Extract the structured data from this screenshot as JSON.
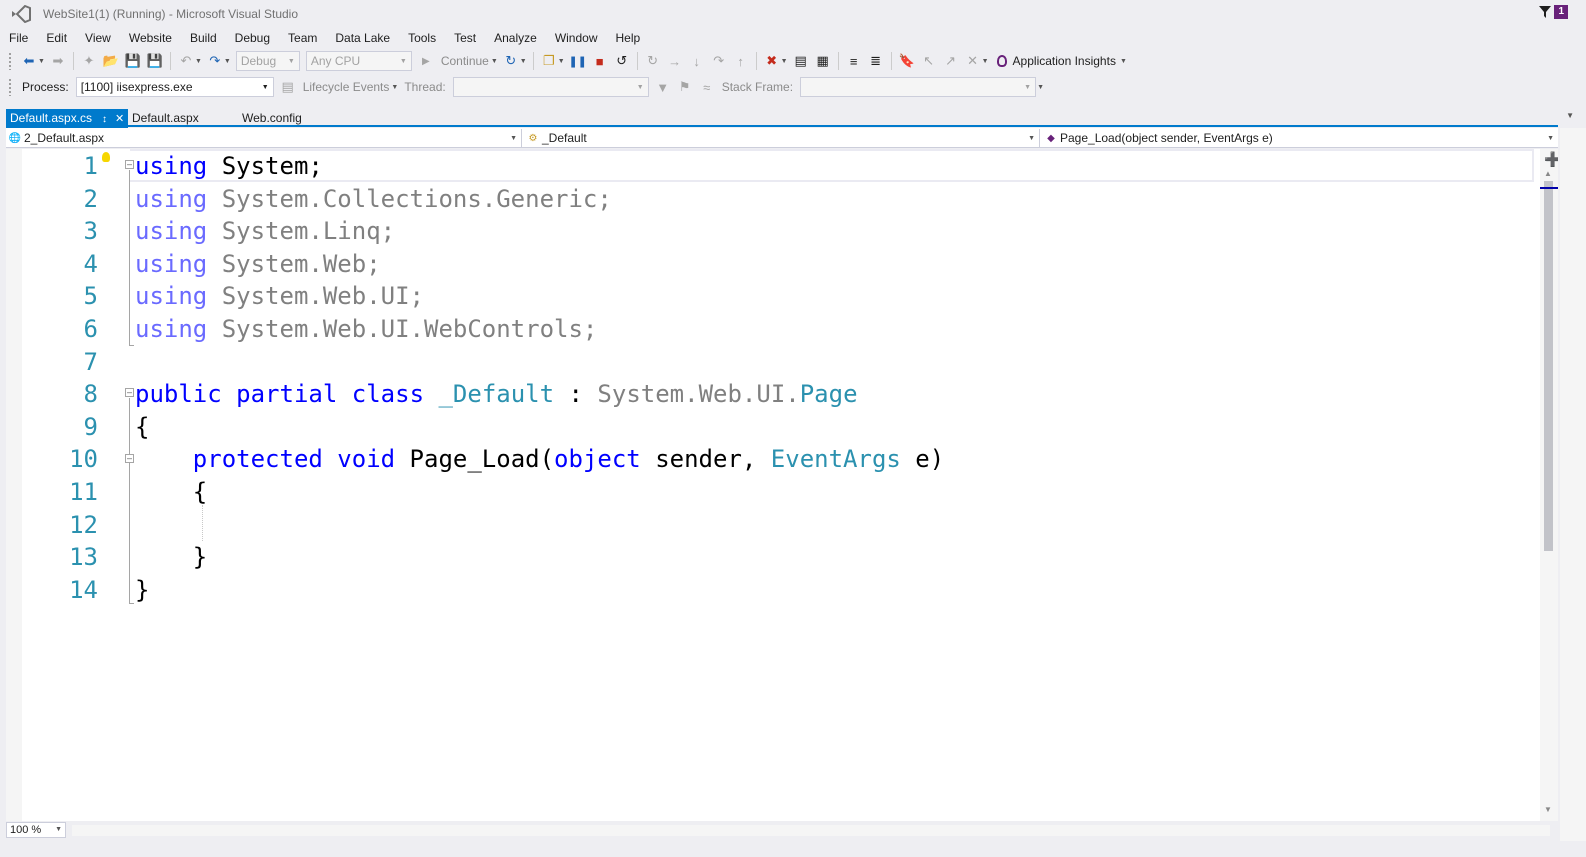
{
  "window": {
    "title": "WebSite1(1) (Running) - Microsoft Visual Studio",
    "notification_count": "1"
  },
  "menu": [
    "File",
    "Edit",
    "View",
    "Website",
    "Build",
    "Debug",
    "Team",
    "Data Lake",
    "Tools",
    "Test",
    "Analyze",
    "Window",
    "Help"
  ],
  "toolbar": {
    "configuration": "Debug",
    "platform": "Any CPU",
    "continue_label": "Continue",
    "app_insights_label": "Application Insights"
  },
  "debug_location": {
    "process_label": "Process:",
    "process_value": "[1100] iisexpress.exe",
    "lifecycle_label": "Lifecycle Events",
    "thread_label": "Thread:",
    "thread_value": "",
    "stack_frame_label": "Stack Frame:",
    "stack_frame_value": ""
  },
  "tabs": [
    {
      "label": "Default.aspx.cs",
      "active": true
    },
    {
      "label": "Default.aspx",
      "active": false
    },
    {
      "label": "Web.config",
      "active": false
    }
  ],
  "navbar": {
    "project": "2_Default.aspx",
    "type": "_Default",
    "member": "Page_Load(object sender, EventArgs e)"
  },
  "code": {
    "line_numbers": [
      "1",
      "2",
      "3",
      "4",
      "5",
      "6",
      "7",
      "8",
      "9",
      "10",
      "11",
      "12",
      "13",
      "14"
    ],
    "lines": [
      [
        {
          "t": "using",
          "c": "kw"
        },
        {
          "t": " System;",
          "c": "plain"
        }
      ],
      [
        {
          "t": "using",
          "c": "kw-fade"
        },
        {
          "t": " System.Collections.Generic;",
          "c": "gray"
        }
      ],
      [
        {
          "t": "using",
          "c": "kw-fade"
        },
        {
          "t": " System.Linq;",
          "c": "gray"
        }
      ],
      [
        {
          "t": "using",
          "c": "kw-fade"
        },
        {
          "t": " System.Web;",
          "c": "gray"
        }
      ],
      [
        {
          "t": "using",
          "c": "kw-fade"
        },
        {
          "t": " System.Web.UI;",
          "c": "gray"
        }
      ],
      [
        {
          "t": "using",
          "c": "kw-fade"
        },
        {
          "t": " System.Web.UI.WebControls;",
          "c": "gray"
        }
      ],
      [],
      [
        {
          "t": "public",
          "c": "kw"
        },
        {
          "t": " ",
          "c": "plain"
        },
        {
          "t": "partial",
          "c": "kw"
        },
        {
          "t": " ",
          "c": "plain"
        },
        {
          "t": "class",
          "c": "kw"
        },
        {
          "t": " ",
          "c": "plain"
        },
        {
          "t": "_Default",
          "c": "type"
        },
        {
          "t": " : ",
          "c": "plain"
        },
        {
          "t": "System.Web.UI.",
          "c": "gray"
        },
        {
          "t": "Page",
          "c": "type"
        }
      ],
      [
        {
          "t": "{",
          "c": "plain"
        }
      ],
      [
        {
          "t": "    ",
          "c": "plain"
        },
        {
          "t": "protected",
          "c": "kw"
        },
        {
          "t": " ",
          "c": "plain"
        },
        {
          "t": "void",
          "c": "kw"
        },
        {
          "t": " Page_Load(",
          "c": "plain"
        },
        {
          "t": "object",
          "c": "kw"
        },
        {
          "t": " sender, ",
          "c": "plain"
        },
        {
          "t": "EventArgs",
          "c": "type"
        },
        {
          "t": " e)",
          "c": "plain"
        }
      ],
      [
        {
          "t": "    {",
          "c": "plain"
        }
      ],
      [],
      [
        {
          "t": "    }",
          "c": "plain"
        }
      ],
      [
        {
          "t": "}",
          "c": "plain"
        }
      ]
    ]
  },
  "zoom": "100 %",
  "colors": {
    "accent": "#007acc",
    "keyword": "#0000ff",
    "type": "#2b91af",
    "line_number": "#2b91af",
    "unused_using": "#808080"
  }
}
